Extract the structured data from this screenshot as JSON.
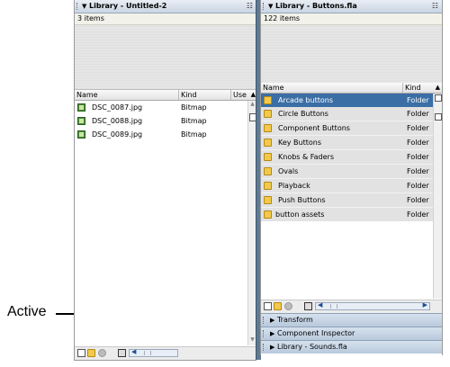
{
  "callout": {
    "label": "Active"
  },
  "left_panel": {
    "title": "Library - Untitled-2",
    "item_count": "3 items",
    "columns": [
      "Name",
      "Kind",
      "Use"
    ],
    "items": [
      {
        "name": "DSC_0087.jpg",
        "kind": "Bitmap",
        "icon": "bitmap-icon"
      },
      {
        "name": "DSC_0088.jpg",
        "kind": "Bitmap",
        "icon": "bitmap-icon"
      },
      {
        "name": "DSC_0089.jpg",
        "kind": "Bitmap",
        "icon": "bitmap-icon"
      }
    ],
    "sort_glyph": "▲",
    "options_glyph": "☷"
  },
  "right_panel": {
    "title": "Library - Buttons.fla",
    "item_count": "122 items",
    "columns": [
      "Name",
      "Kind"
    ],
    "items": [
      {
        "name": "Arcade buttons",
        "kind": "Folder",
        "icon": "folder-icon",
        "selected": true
      },
      {
        "name": "Circle Buttons",
        "kind": "Folder",
        "icon": "folder-icon"
      },
      {
        "name": "Component Buttons",
        "kind": "Folder",
        "icon": "folder-icon"
      },
      {
        "name": "Key Buttons",
        "kind": "Folder",
        "icon": "folder-icon"
      },
      {
        "name": "Knobs & Faders",
        "kind": "Folder",
        "icon": "folder-icon"
      },
      {
        "name": "Ovals",
        "kind": "Folder",
        "icon": "folder-icon"
      },
      {
        "name": "Playback",
        "kind": "Folder",
        "icon": "folder-icon"
      },
      {
        "name": "Push Buttons",
        "kind": "Folder",
        "icon": "folder-icon"
      },
      {
        "name": "button assets",
        "kind": "Folder",
        "icon": "folder-icon"
      }
    ],
    "sort_glyph": "▲",
    "options_glyph": "☷"
  },
  "collapsed_panels": [
    {
      "label": "Transform"
    },
    {
      "label": "Component Inspector"
    },
    {
      "label": "Library - Sounds.fla"
    }
  ],
  "glyphs": {
    "expand": "▶",
    "collapse": "▼",
    "scroll_left": "◀",
    "scroll_right": "▶"
  },
  "colors": {
    "selection": "#3a6ea5",
    "splitter": "#5f7a93",
    "panel_header": "#c9d5e3"
  }
}
